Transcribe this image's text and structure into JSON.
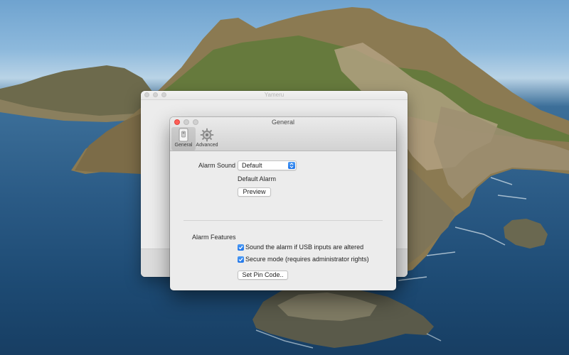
{
  "back_window": {
    "title": "Yameru"
  },
  "pref_window": {
    "title": "General",
    "tabs": [
      {
        "label": "General",
        "icon": "usb-drive-icon",
        "selected": true
      },
      {
        "label": "Advanced",
        "icon": "gear-icon",
        "selected": false
      }
    ],
    "alarm_sound": {
      "label": "Alarm Sound",
      "selected_value": "Default",
      "description": "Default Alarm",
      "preview_button": "Preview"
    },
    "alarm_features": {
      "label": "Alarm Features",
      "options": [
        {
          "label": "Sound the alarm if USB inputs are altered",
          "checked": true
        },
        {
          "label": "Secure mode (requires administrator rights)",
          "checked": true
        }
      ],
      "set_pin_button": "Set Pin Code.."
    }
  },
  "colors": {
    "accent": "#1f74e8",
    "close_button": "#fe5f57"
  }
}
